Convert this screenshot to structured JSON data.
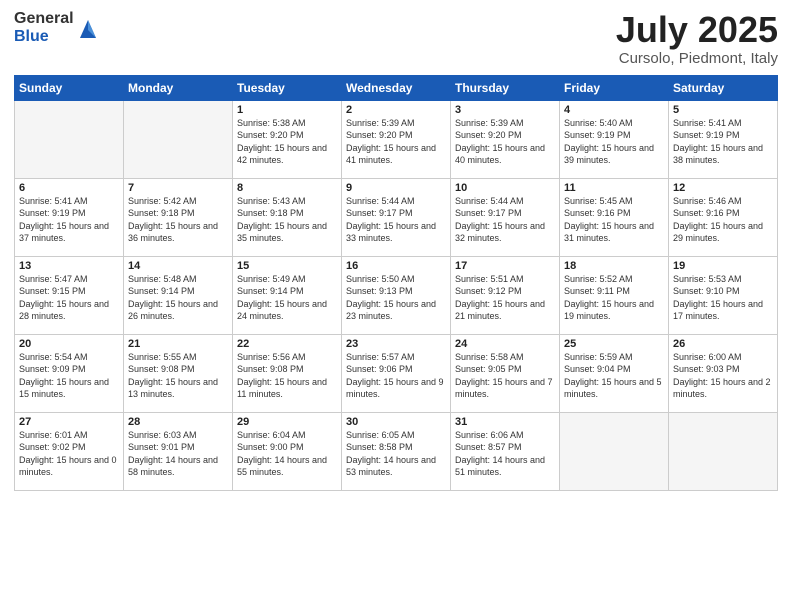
{
  "header": {
    "logo": {
      "line1": "General",
      "line2": "Blue"
    },
    "title": "July 2025",
    "location": "Cursolo, Piedmont, Italy"
  },
  "weekdays": [
    "Sunday",
    "Monday",
    "Tuesday",
    "Wednesday",
    "Thursday",
    "Friday",
    "Saturday"
  ],
  "weeks": [
    [
      {
        "day": "",
        "sunrise": "",
        "sunset": "",
        "daylight": ""
      },
      {
        "day": "",
        "sunrise": "",
        "sunset": "",
        "daylight": ""
      },
      {
        "day": "1",
        "sunrise": "Sunrise: 5:38 AM",
        "sunset": "Sunset: 9:20 PM",
        "daylight": "Daylight: 15 hours and 42 minutes."
      },
      {
        "day": "2",
        "sunrise": "Sunrise: 5:39 AM",
        "sunset": "Sunset: 9:20 PM",
        "daylight": "Daylight: 15 hours and 41 minutes."
      },
      {
        "day": "3",
        "sunrise": "Sunrise: 5:39 AM",
        "sunset": "Sunset: 9:20 PM",
        "daylight": "Daylight: 15 hours and 40 minutes."
      },
      {
        "day": "4",
        "sunrise": "Sunrise: 5:40 AM",
        "sunset": "Sunset: 9:19 PM",
        "daylight": "Daylight: 15 hours and 39 minutes."
      },
      {
        "day": "5",
        "sunrise": "Sunrise: 5:41 AM",
        "sunset": "Sunset: 9:19 PM",
        "daylight": "Daylight: 15 hours and 38 minutes."
      }
    ],
    [
      {
        "day": "6",
        "sunrise": "Sunrise: 5:41 AM",
        "sunset": "Sunset: 9:19 PM",
        "daylight": "Daylight: 15 hours and 37 minutes."
      },
      {
        "day": "7",
        "sunrise": "Sunrise: 5:42 AM",
        "sunset": "Sunset: 9:18 PM",
        "daylight": "Daylight: 15 hours and 36 minutes."
      },
      {
        "day": "8",
        "sunrise": "Sunrise: 5:43 AM",
        "sunset": "Sunset: 9:18 PM",
        "daylight": "Daylight: 15 hours and 35 minutes."
      },
      {
        "day": "9",
        "sunrise": "Sunrise: 5:44 AM",
        "sunset": "Sunset: 9:17 PM",
        "daylight": "Daylight: 15 hours and 33 minutes."
      },
      {
        "day": "10",
        "sunrise": "Sunrise: 5:44 AM",
        "sunset": "Sunset: 9:17 PM",
        "daylight": "Daylight: 15 hours and 32 minutes."
      },
      {
        "day": "11",
        "sunrise": "Sunrise: 5:45 AM",
        "sunset": "Sunset: 9:16 PM",
        "daylight": "Daylight: 15 hours and 31 minutes."
      },
      {
        "day": "12",
        "sunrise": "Sunrise: 5:46 AM",
        "sunset": "Sunset: 9:16 PM",
        "daylight": "Daylight: 15 hours and 29 minutes."
      }
    ],
    [
      {
        "day": "13",
        "sunrise": "Sunrise: 5:47 AM",
        "sunset": "Sunset: 9:15 PM",
        "daylight": "Daylight: 15 hours and 28 minutes."
      },
      {
        "day": "14",
        "sunrise": "Sunrise: 5:48 AM",
        "sunset": "Sunset: 9:14 PM",
        "daylight": "Daylight: 15 hours and 26 minutes."
      },
      {
        "day": "15",
        "sunrise": "Sunrise: 5:49 AM",
        "sunset": "Sunset: 9:14 PM",
        "daylight": "Daylight: 15 hours and 24 minutes."
      },
      {
        "day": "16",
        "sunrise": "Sunrise: 5:50 AM",
        "sunset": "Sunset: 9:13 PM",
        "daylight": "Daylight: 15 hours and 23 minutes."
      },
      {
        "day": "17",
        "sunrise": "Sunrise: 5:51 AM",
        "sunset": "Sunset: 9:12 PM",
        "daylight": "Daylight: 15 hours and 21 minutes."
      },
      {
        "day": "18",
        "sunrise": "Sunrise: 5:52 AM",
        "sunset": "Sunset: 9:11 PM",
        "daylight": "Daylight: 15 hours and 19 minutes."
      },
      {
        "day": "19",
        "sunrise": "Sunrise: 5:53 AM",
        "sunset": "Sunset: 9:10 PM",
        "daylight": "Daylight: 15 hours and 17 minutes."
      }
    ],
    [
      {
        "day": "20",
        "sunrise": "Sunrise: 5:54 AM",
        "sunset": "Sunset: 9:09 PM",
        "daylight": "Daylight: 15 hours and 15 minutes."
      },
      {
        "day": "21",
        "sunrise": "Sunrise: 5:55 AM",
        "sunset": "Sunset: 9:08 PM",
        "daylight": "Daylight: 15 hours and 13 minutes."
      },
      {
        "day": "22",
        "sunrise": "Sunrise: 5:56 AM",
        "sunset": "Sunset: 9:08 PM",
        "daylight": "Daylight: 15 hours and 11 minutes."
      },
      {
        "day": "23",
        "sunrise": "Sunrise: 5:57 AM",
        "sunset": "Sunset: 9:06 PM",
        "daylight": "Daylight: 15 hours and 9 minutes."
      },
      {
        "day": "24",
        "sunrise": "Sunrise: 5:58 AM",
        "sunset": "Sunset: 9:05 PM",
        "daylight": "Daylight: 15 hours and 7 minutes."
      },
      {
        "day": "25",
        "sunrise": "Sunrise: 5:59 AM",
        "sunset": "Sunset: 9:04 PM",
        "daylight": "Daylight: 15 hours and 5 minutes."
      },
      {
        "day": "26",
        "sunrise": "Sunrise: 6:00 AM",
        "sunset": "Sunset: 9:03 PM",
        "daylight": "Daylight: 15 hours and 2 minutes."
      }
    ],
    [
      {
        "day": "27",
        "sunrise": "Sunrise: 6:01 AM",
        "sunset": "Sunset: 9:02 PM",
        "daylight": "Daylight: 15 hours and 0 minutes."
      },
      {
        "day": "28",
        "sunrise": "Sunrise: 6:03 AM",
        "sunset": "Sunset: 9:01 PM",
        "daylight": "Daylight: 14 hours and 58 minutes."
      },
      {
        "day": "29",
        "sunrise": "Sunrise: 6:04 AM",
        "sunset": "Sunset: 9:00 PM",
        "daylight": "Daylight: 14 hours and 55 minutes."
      },
      {
        "day": "30",
        "sunrise": "Sunrise: 6:05 AM",
        "sunset": "Sunset: 8:58 PM",
        "daylight": "Daylight: 14 hours and 53 minutes."
      },
      {
        "day": "31",
        "sunrise": "Sunrise: 6:06 AM",
        "sunset": "Sunset: 8:57 PM",
        "daylight": "Daylight: 14 hours and 51 minutes."
      },
      {
        "day": "",
        "sunrise": "",
        "sunset": "",
        "daylight": ""
      },
      {
        "day": "",
        "sunrise": "",
        "sunset": "",
        "daylight": ""
      }
    ]
  ]
}
